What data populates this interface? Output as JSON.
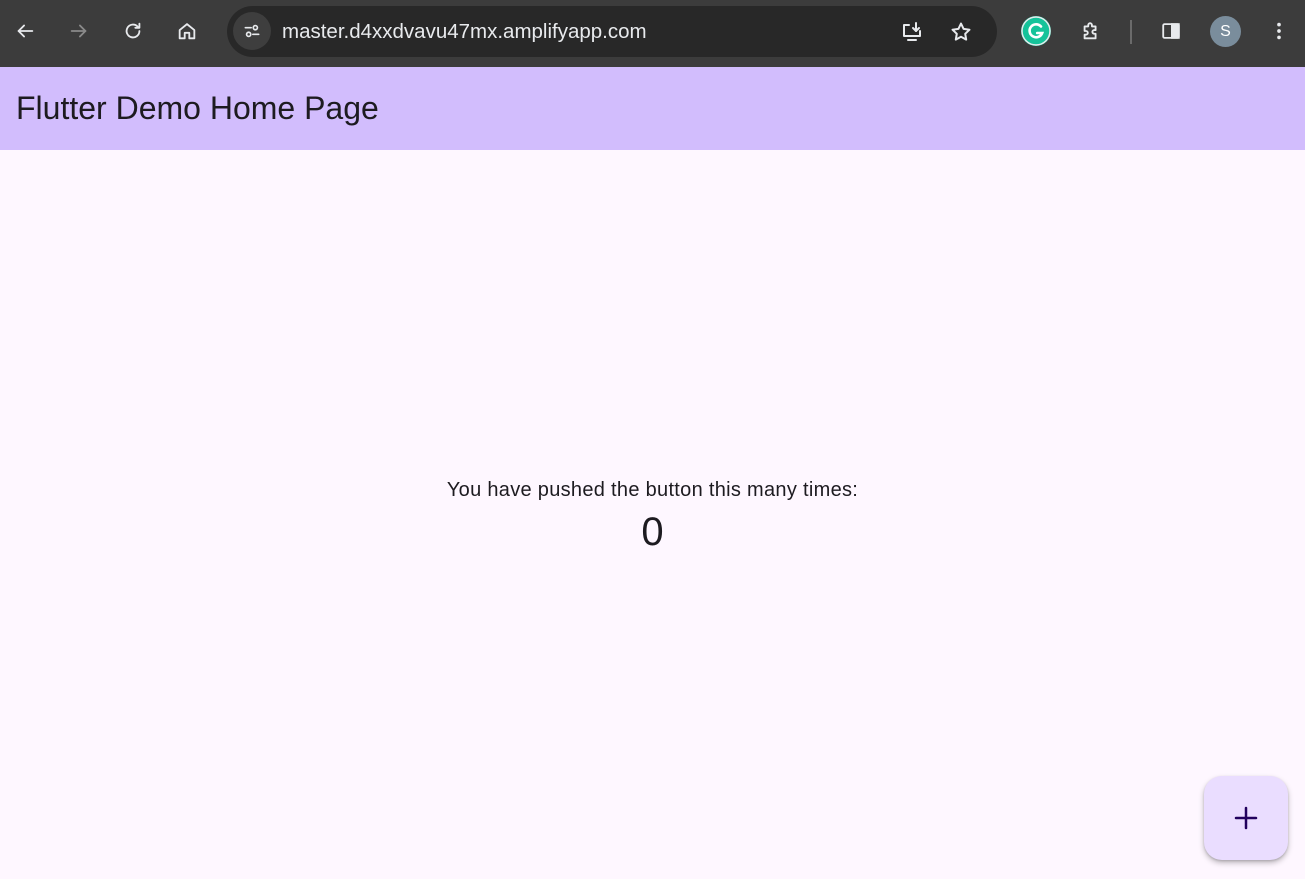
{
  "browser": {
    "url": "master.d4xxdvavu47mx.amplifyapp.com",
    "profile_initial": "S",
    "icons": {
      "back": "arrow-left-icon",
      "forward": "arrow-right-icon",
      "reload": "reload-icon",
      "home": "home-icon",
      "site_info": "tune-icon",
      "install": "install-app-icon",
      "bookmark": "star-icon",
      "grammarly": "grammarly-icon",
      "extensions": "puzzle-icon",
      "side_panel": "side-panel-icon",
      "menu": "kebab-menu-icon"
    }
  },
  "app": {
    "title": "Flutter Demo Home Page",
    "counter_label": "You have pushed the button this many times:",
    "counter_value": "0",
    "fab_icon": "plus-icon"
  },
  "colors": {
    "appbar": "#d2bdfd",
    "background": "#fef7ff",
    "fab": "#eaddff",
    "browser_chrome": "#3c3c3c"
  }
}
